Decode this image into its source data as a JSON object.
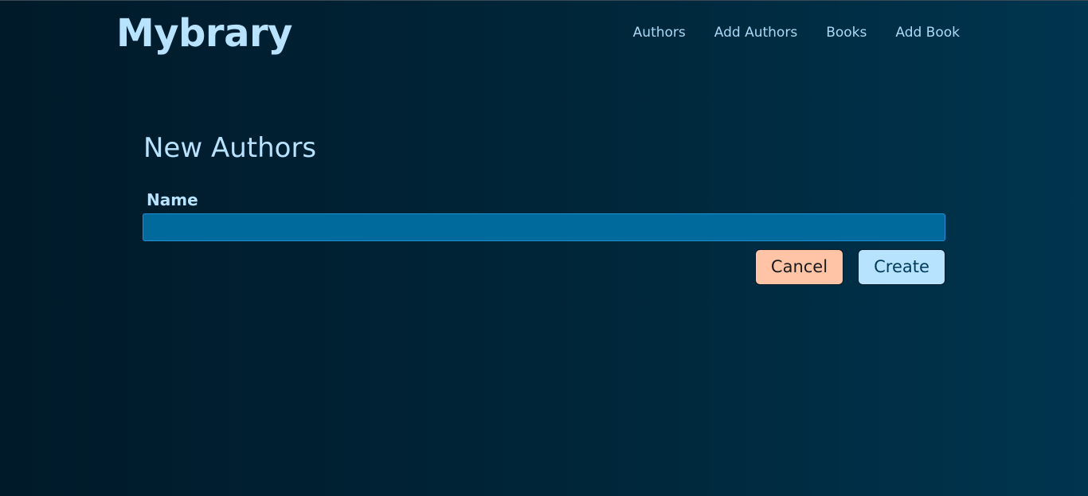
{
  "header": {
    "logo": "Mybrary",
    "nav": [
      {
        "label": "Authors"
      },
      {
        "label": "Add Authors"
      },
      {
        "label": "Books"
      },
      {
        "label": "Add Book"
      }
    ]
  },
  "main": {
    "title": "New Authors",
    "form": {
      "name_label": "Name",
      "name_value": "",
      "cancel_label": "Cancel",
      "create_label": "Create"
    }
  },
  "colors": {
    "background_start": "#001a29",
    "background_end": "#00354f",
    "accent_text": "#b7e3ff",
    "input_fill": "#006a9c",
    "cancel_fill": "#ffc3a6",
    "create_fill": "#b7e3ff"
  }
}
